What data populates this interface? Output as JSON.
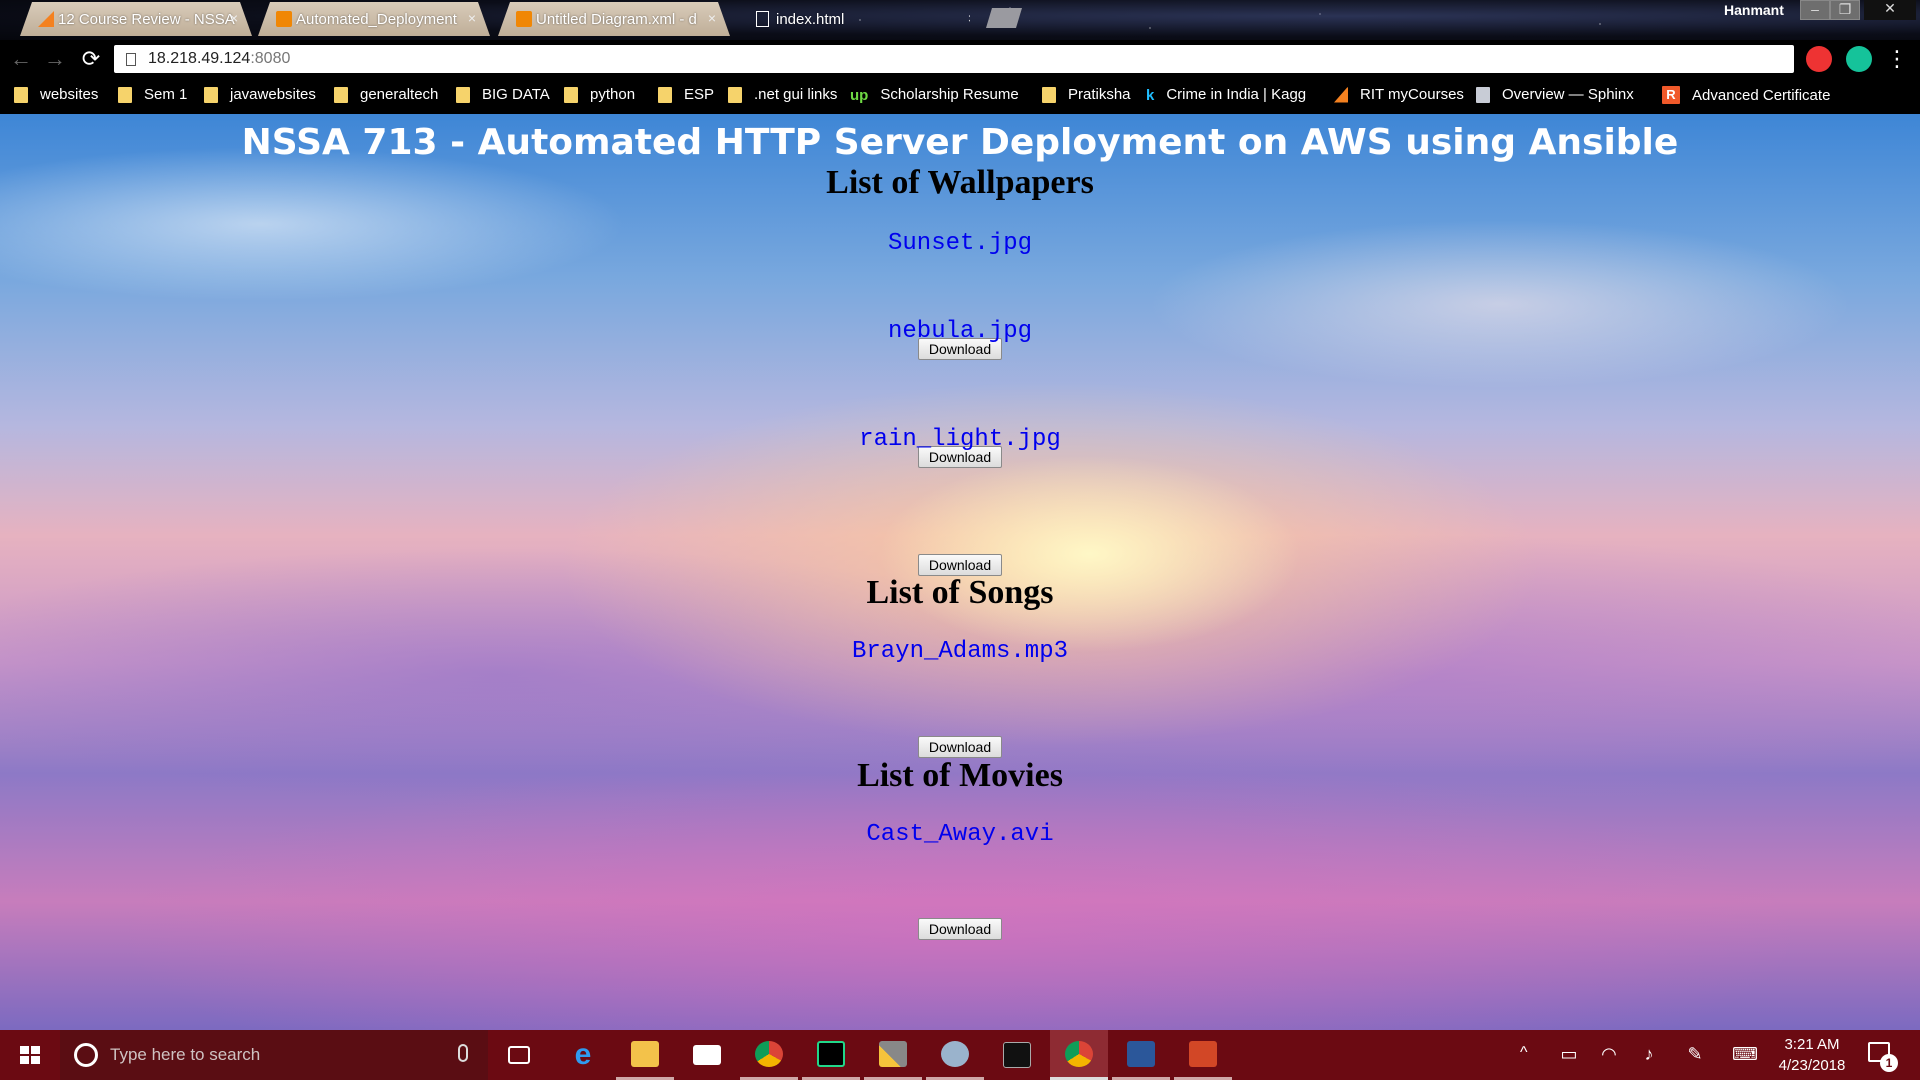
{
  "browser": {
    "tabs": [
      {
        "label": "12 Course Review - NSSA",
        "close": "×",
        "favicon_color": "#f48120"
      },
      {
        "label": "Automated_Deployment",
        "close": "×",
        "favicon_color": "#f08705"
      },
      {
        "label": "Untitled Diagram.xml - d",
        "close": "×",
        "favicon_color": "#f08705"
      },
      {
        "label": "index.html",
        "close": "×"
      }
    ],
    "user_name": "Hanmant",
    "window_buttons": {
      "minimize": "–",
      "restore": "❐",
      "close": "✕"
    },
    "nav": {
      "back": "←",
      "forward": "→",
      "reload": "⟳"
    },
    "url": {
      "host": "18.218.49.124",
      "port": ":8080"
    },
    "menu_icon": "⋮"
  },
  "bookmarks": [
    {
      "label": "websites",
      "icon": "folder-icon"
    },
    {
      "label": "Sem 1",
      "icon": "folder-icon"
    },
    {
      "label": "javawebsites",
      "icon": "folder-icon"
    },
    {
      "label": "generaltech",
      "icon": "folder-icon"
    },
    {
      "label": "BIG DATA",
      "icon": "folder-icon"
    },
    {
      "label": "python",
      "icon": "folder-icon"
    },
    {
      "label": "ESP",
      "icon": "folder-icon"
    },
    {
      "label": ".net gui links",
      "icon": "folder-icon"
    },
    {
      "label": "Scholarship Resume",
      "icon": "upwork-icon"
    },
    {
      "label": "Pratiksha",
      "icon": "folder-icon"
    },
    {
      "label": "Crime in India | Kagg",
      "icon": "kaggle-icon"
    },
    {
      "label": "RIT myCourses",
      "icon": "d2l-icon"
    },
    {
      "label": "Overview — Sphinx",
      "icon": "sphinx-icon"
    },
    {
      "label": "Advanced Certificate",
      "icon": "r-icon"
    }
  ],
  "page": {
    "title": "NSSA 713 - Automated HTTP Server Deployment on AWS using Ansible",
    "sections": [
      {
        "heading": "List of Wallpapers",
        "files": [
          "Sunset.jpg",
          "nebula.jpg",
          "rain_light.jpg"
        ]
      },
      {
        "heading": "List of Songs",
        "files": [
          "Brayn_Adams.mp3"
        ]
      },
      {
        "heading": "List of Movies",
        "files": [
          "Cast_Away.avi"
        ]
      }
    ],
    "download_label": "Download"
  },
  "taskbar": {
    "search_placeholder": "Type here to search",
    "apps": [
      "task-view",
      "edge",
      "file-explorer",
      "mail",
      "chrome",
      "pycharm",
      "tools",
      "r-studio",
      "terminal",
      "chrome-active",
      "word",
      "powerpoint"
    ],
    "tray_arrow": "^",
    "time": "3:21 AM",
    "date": "4/23/2018",
    "notification_count": "1"
  }
}
